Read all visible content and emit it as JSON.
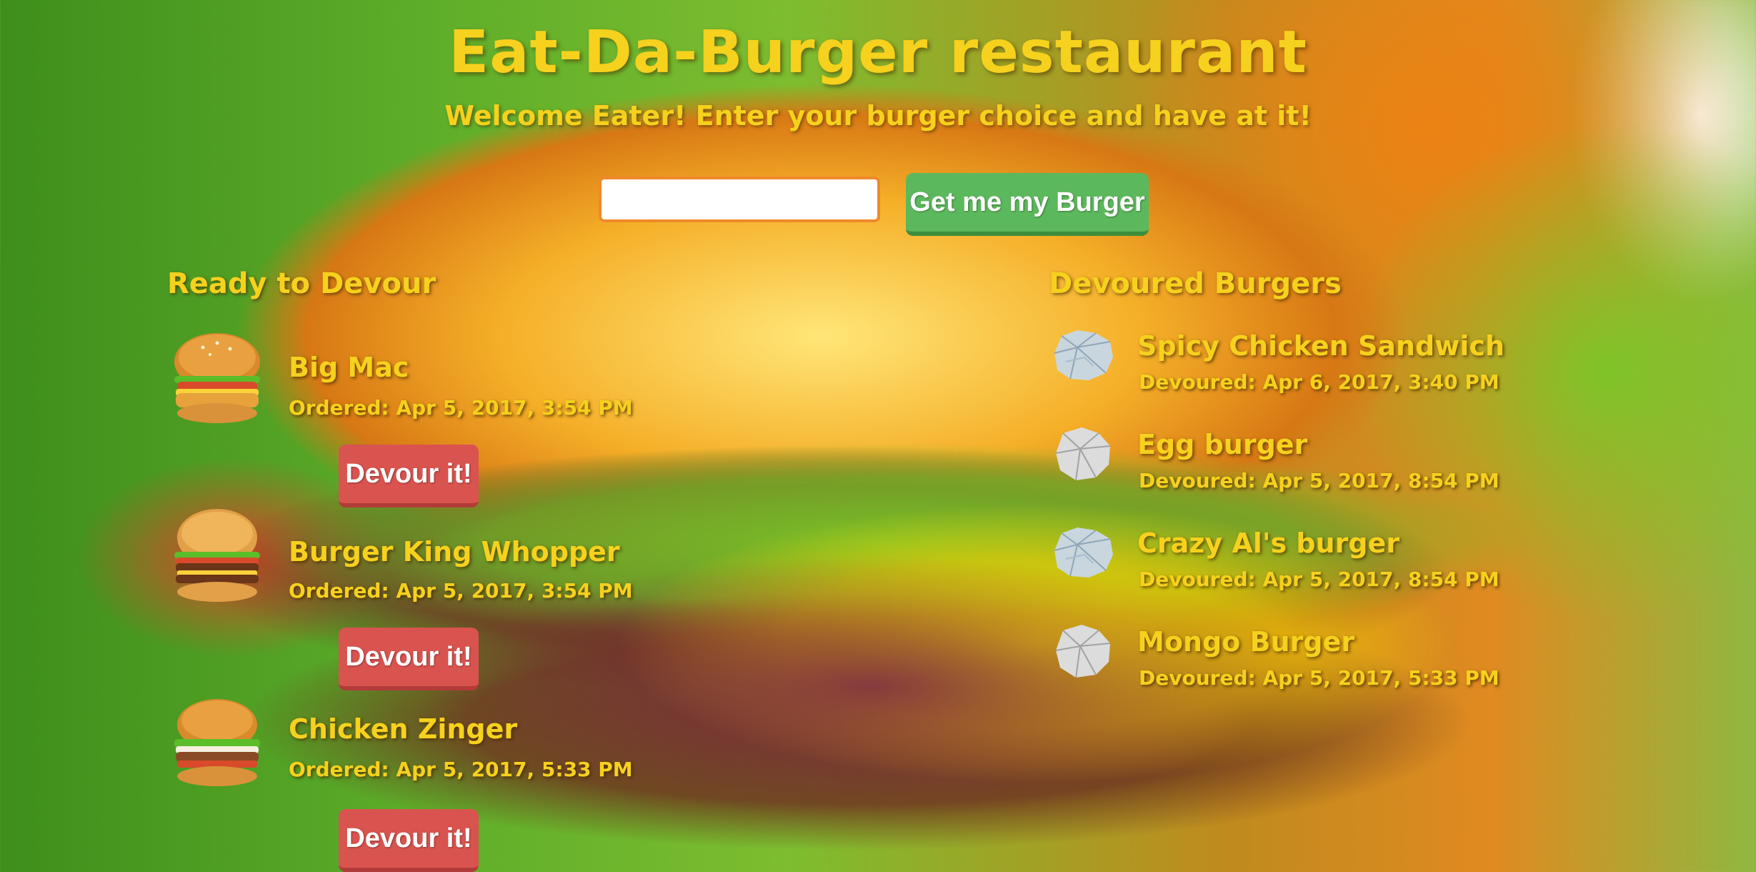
{
  "header": {
    "title": "Eat-Da-Burger restaurant",
    "subtitle": "Welcome Eater! Enter your burger choice and have at it!"
  },
  "form": {
    "input_value": "",
    "input_placeholder": "",
    "submit_label": "Get me my Burger"
  },
  "colors": {
    "heading_text": "#f6d11d",
    "submit_button": "#5cb85c",
    "devour_button": "#d9534f",
    "input_border": "#ef8a2b"
  },
  "ready": {
    "heading": "Ready to Devour",
    "items": [
      {
        "name": "Big Mac",
        "ordered": "Ordered: Apr 5, 2017, 3:54 PM",
        "button_label": "Devour it!",
        "icon": "burger-icon"
      },
      {
        "name": "Burger King Whopper",
        "ordered": "Ordered: Apr 5, 2017, 3:54 PM",
        "button_label": "Devour it!",
        "icon": "burger-icon"
      },
      {
        "name": "Chicken Zinger",
        "ordered": "Ordered: Apr 5, 2017, 5:33 PM",
        "button_label": "Devour it!",
        "icon": "burger-icon"
      }
    ]
  },
  "devoured": {
    "heading": "Devoured Burgers",
    "items": [
      {
        "name": "Spicy Chicken Sandwich",
        "devoured": "Devoured: Apr 6, 2017, 3:40 PM",
        "icon": "crumpled-wrapper-icon"
      },
      {
        "name": "Egg burger",
        "devoured": "Devoured: Apr 5, 2017, 8:54 PM",
        "icon": "crumpled-wrapper-icon"
      },
      {
        "name": "Crazy Al's burger",
        "devoured": "Devoured: Apr 5, 2017, 8:54 PM",
        "icon": "crumpled-wrapper-icon"
      },
      {
        "name": "Mongo Burger",
        "devoured": "Devoured: Apr 5, 2017, 5:33 PM",
        "icon": "crumpled-wrapper-icon"
      }
    ]
  }
}
